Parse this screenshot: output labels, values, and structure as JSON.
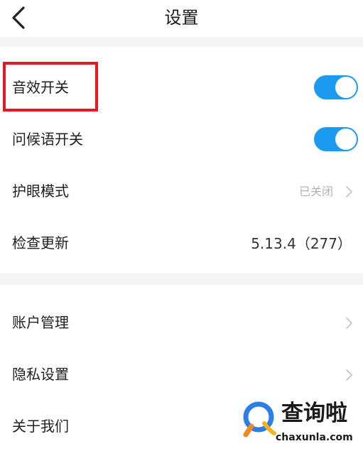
{
  "header": {
    "title": "设置",
    "back_icon": "chevron-left-icon"
  },
  "sections": [
    {
      "rows": [
        {
          "label": "音效开关",
          "control": "toggle",
          "on": true,
          "highlighted": true
        },
        {
          "label": "问候语开关",
          "control": "toggle",
          "on": true
        },
        {
          "label": "护眼模式",
          "value": "已关闭",
          "chevron": true
        },
        {
          "label": "检查更新",
          "value": "5.13.4（277）"
        }
      ]
    },
    {
      "rows": [
        {
          "label": "账户管理",
          "chevron": true
        },
        {
          "label": "隐私设置",
          "chevron": true
        },
        {
          "label": "关于我们",
          "chevron": true
        }
      ]
    }
  ],
  "watermark": {
    "text": "查询啦",
    "url": "chaxunla.com",
    "icon": "magnifier-logo-icon"
  },
  "colors": {
    "toggle_on": "#1a9bf0",
    "highlight": "#e01b24",
    "divider": "#f2f3f5",
    "muted_text": "#b3b3b3"
  }
}
